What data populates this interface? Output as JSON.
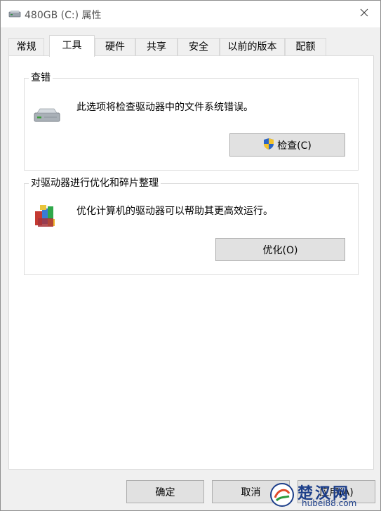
{
  "window": {
    "title": "480GB (C:) 属性",
    "close_glyph": "✕"
  },
  "tabs": [
    {
      "label": "常规"
    },
    {
      "label": "工具"
    },
    {
      "label": "硬件"
    },
    {
      "label": "共享"
    },
    {
      "label": "安全"
    },
    {
      "label": "以前的版本"
    },
    {
      "label": "配额"
    }
  ],
  "active_tab": "工具",
  "check_group": {
    "title": "查错",
    "description": "此选项将检查驱动器中的文件系统错误。",
    "button_label": "检查(C)",
    "button_icon": "uac-shield-icon"
  },
  "optimize_group": {
    "title": "对驱动器进行优化和碎片整理",
    "description": "优化计算机的驱动器可以帮助其更高效运行。",
    "button_label": "优化(O)",
    "button_icon": "defrag-icon"
  },
  "footer": {
    "ok_label": "确定",
    "cancel_label": "取消",
    "apply_label": "应用(A)"
  },
  "watermark": {
    "text": "楚汉网",
    "sub": "hubei88.com"
  },
  "colors": {
    "accent": "#0078d7",
    "button_bg": "#e1e1e1",
    "panel_bg": "#ffffff",
    "window_bg": "#f0f0f0"
  }
}
